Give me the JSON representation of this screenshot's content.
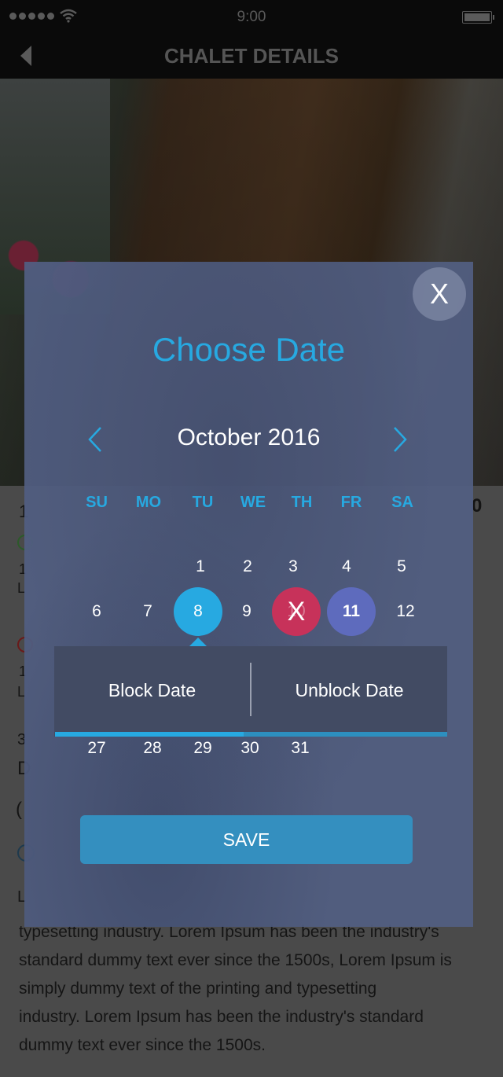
{
  "status_bar": {
    "time": "9:00",
    "signal_icon": "signal-dots-icon",
    "wifi_icon": "wifi-icon",
    "battery_icon": "battery-icon"
  },
  "nav": {
    "title": "CHALET DETAILS",
    "back_icon": "chevron-left-icon"
  },
  "background_content": {
    "partial_texts": [
      "1",
      "1",
      "L",
      "1",
      "L",
      "3",
      "D",
      "(",
      "L",
      "0"
    ],
    "lorem_lines": [
      "typesetting industry. Lorem Ipsum has been the industry's",
      "standard dummy text ever since the 1500s, Lorem Ipsum is",
      "simply dummy text of the printing and typesetting",
      "industry. Lorem Ipsum has been the industry's standard",
      "dummy text ever since the 1500s."
    ]
  },
  "modal": {
    "close_label": "X",
    "title": "Choose Date",
    "month_label": "October 2016",
    "prev_icon": "chevron-left-icon",
    "next_icon": "chevron-right-icon",
    "weekdays": [
      "SU",
      "MO",
      "TU",
      "WE",
      "TH",
      "FR",
      "SA"
    ],
    "row1": [
      "1",
      "2",
      "3",
      "4",
      "5"
    ],
    "row2": [
      "6",
      "7",
      "8",
      "9",
      "10",
      "11",
      "12"
    ],
    "row_last": [
      "27",
      "28",
      "29",
      "30",
      "31"
    ],
    "selected_day": "8",
    "blocked_day": "10",
    "blocked_marker": "X",
    "unblocked_day": "11",
    "actions": {
      "block_label": "Block Date",
      "unblock_label": "Unblock Date",
      "active_tab": "block"
    },
    "save_label": "SAVE"
  }
}
